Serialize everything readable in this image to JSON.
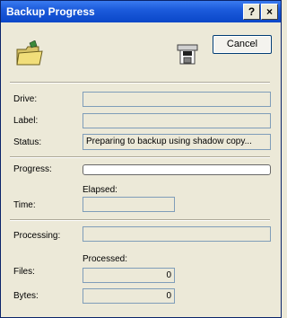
{
  "window": {
    "title": "Backup Progress"
  },
  "titlebar": {
    "help_label": "?",
    "close_label": "×"
  },
  "buttons": {
    "cancel_label": "Cancel"
  },
  "labels": {
    "drive": "Drive:",
    "label": "Label:",
    "status": "Status:",
    "progress": "Progress:",
    "elapsed": "Elapsed:",
    "time": "Time:",
    "processing": "Processing:",
    "processed": "Processed:",
    "files": "Files:",
    "bytes": "Bytes:"
  },
  "values": {
    "drive": "",
    "label": "",
    "status": "Preparing to backup using shadow copy...",
    "progress_fraction": 0,
    "time": "",
    "processing": "",
    "files": "0",
    "bytes": "0"
  },
  "icons": [
    "folder-icon",
    "backup-device-icon"
  ]
}
